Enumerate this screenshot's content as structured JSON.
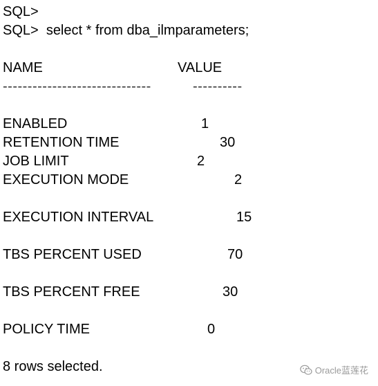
{
  "console": {
    "prompt_line_1": "SQL>",
    "prompt_line_2": "SQL>  select * from dba_ilmparameters;",
    "header_name": "NAME",
    "header_value": "VALUE",
    "separator_name": "------------------------------",
    "separator_value": "----------",
    "rows": [
      {
        "name": "ENABLED",
        "value": "1"
      },
      {
        "name": "RETENTION TIME",
        "value": "30"
      },
      {
        "name": "JOB LIMIT",
        "value": "2"
      },
      {
        "name": "EXECUTION MODE",
        "value": "2"
      },
      {
        "name": "EXECUTION INTERVAL",
        "value": "15"
      },
      {
        "name": "TBS PERCENT USED",
        "value": "70"
      },
      {
        "name": "TBS PERCENT FREE",
        "value": "30"
      },
      {
        "name": "POLICY TIME",
        "value": "0"
      }
    ],
    "footer": "8 rows selected."
  },
  "watermark": {
    "text": "Oracle蓝莲花",
    "icon": "wechat-icon"
  }
}
